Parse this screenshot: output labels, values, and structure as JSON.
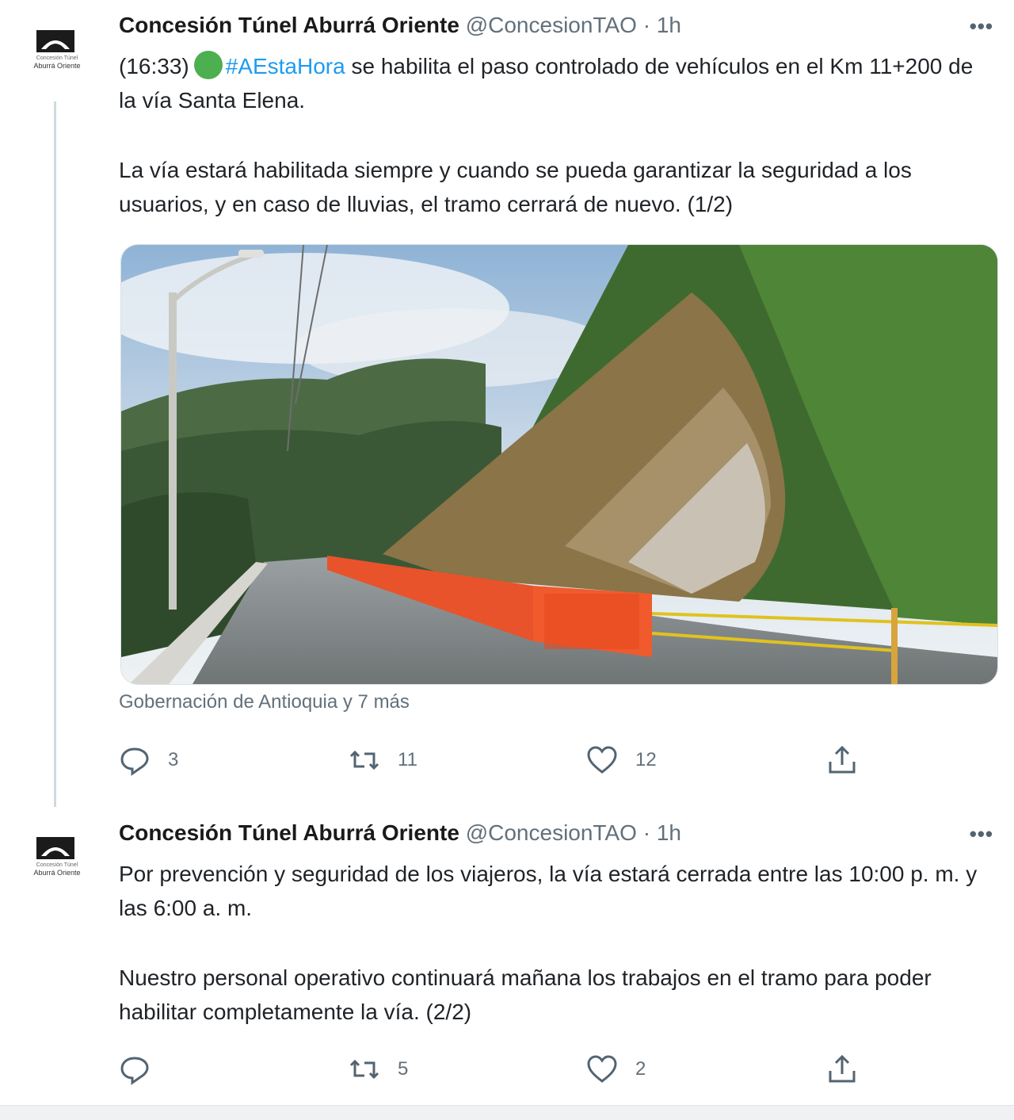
{
  "tweets": [
    {
      "author_name": "Concesión Túnel Aburrá Oriente",
      "handle": "@ConcesionTAO",
      "separator": " · ",
      "time": "1h",
      "more": "•••",
      "avatar_text_small": "Concesión Túnel",
      "avatar_text": "Aburrá Oriente",
      "text_prefix": "(16:33)",
      "status_emoji": "green-circle",
      "hashtag": "#AEstaHora",
      "text_line1_rest": " se habilita el paso controlado de vehículos en el Km 11+200 de la vía Santa Elena.",
      "text_paragraph2": "La vía estará habilitada siempre y cuando se pueda garantizar la seguridad a los usuarios, y en caso de lluvias, el tramo cerrará de nuevo. (1/2)",
      "tagged": "Gobernación de Antioquia y 7 más",
      "replies": "3",
      "retweets": "11",
      "likes": "12"
    },
    {
      "author_name": "Concesión Túnel Aburrá Oriente",
      "handle": "@ConcesionTAO",
      "separator": " · ",
      "time": "1h",
      "more": "•••",
      "avatar_text_small": "Concesión Túnel",
      "avatar_text": "Aburrá Oriente",
      "text_paragraph1": "Por prevención y seguridad de los viajeros, la vía estará cerrada entre las 10:00 p. m. y las 6:00 a. m.",
      "text_paragraph2": "Nuestro personal operativo continuará mañana los trabajos en el tramo para poder habilitar completamente la vía. (2/2)",
      "replies": "",
      "retweets": "5",
      "likes": "2"
    }
  ],
  "colors": {
    "link": "#1d9bf0",
    "muted": "#62707b",
    "thread_line": "#cfd9de",
    "status_dot": "#4caf50"
  },
  "icons": [
    "reply-icon",
    "retweet-icon",
    "like-icon",
    "share-icon",
    "more-icon"
  ]
}
